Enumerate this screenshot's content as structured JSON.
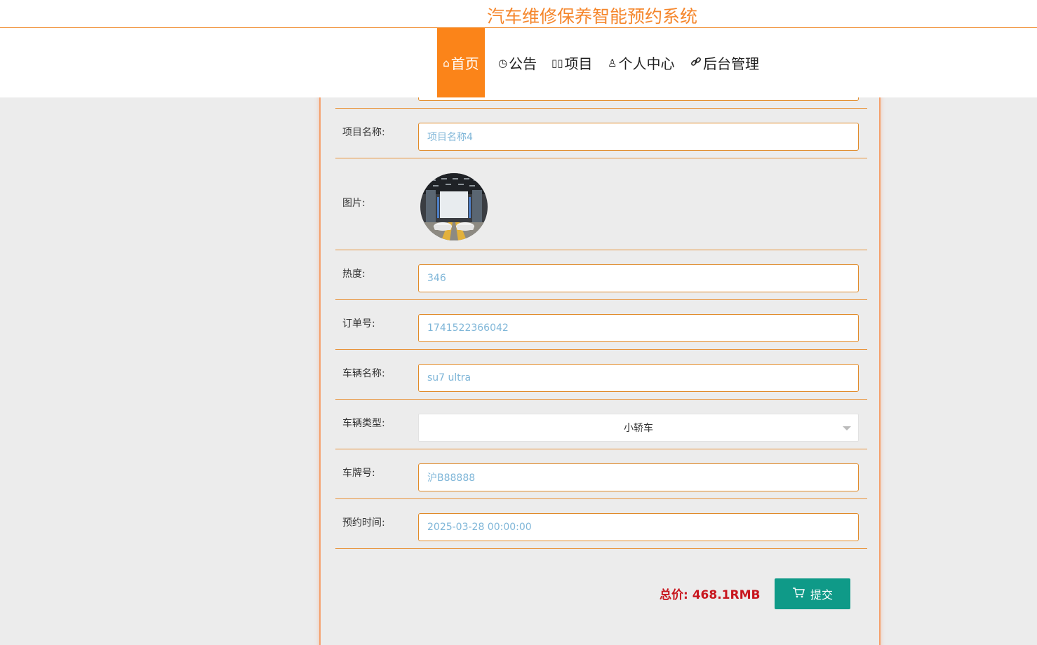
{
  "header": {
    "title": "汽车维修保养智能预约系统"
  },
  "nav": {
    "items": [
      {
        "icon": "home-icon",
        "glyph": "⌂",
        "label": "首页"
      },
      {
        "icon": "clock-icon",
        "glyph": "◷",
        "label": "公告"
      },
      {
        "icon": "columns-icon",
        "glyph": "▯▯",
        "label": "项目"
      },
      {
        "icon": "user-icon",
        "glyph": "♙",
        "label": "个人中心"
      },
      {
        "icon": "link-icon",
        "glyph": "🔗",
        "label": "后台管理"
      }
    ]
  },
  "form": {
    "project_name_label": "项目名称:",
    "project_name_value": "项目名称4",
    "image_label": "图片:",
    "heat_label": "热度:",
    "heat_value": "346",
    "order_label": "订单号:",
    "order_value": "1741522366042",
    "vehicle_name_label": "车辆名称:",
    "vehicle_name_value": "su7 ultra",
    "vehicle_type_label": "车辆类型:",
    "vehicle_type_value": "小轿车",
    "plate_label": "车牌号:",
    "plate_value": "沪B88888",
    "time_label": "预约时间:",
    "time_value": "2025-03-28 00:00:00"
  },
  "footer": {
    "total_text": "总价:  468.1RMB",
    "submit_label": "提交"
  },
  "colors": {
    "accent": "#fb8419",
    "title": "#f5862b",
    "field_border": "#e08a28",
    "submit_bg": "#0f9a88",
    "total": "#c8161e"
  }
}
